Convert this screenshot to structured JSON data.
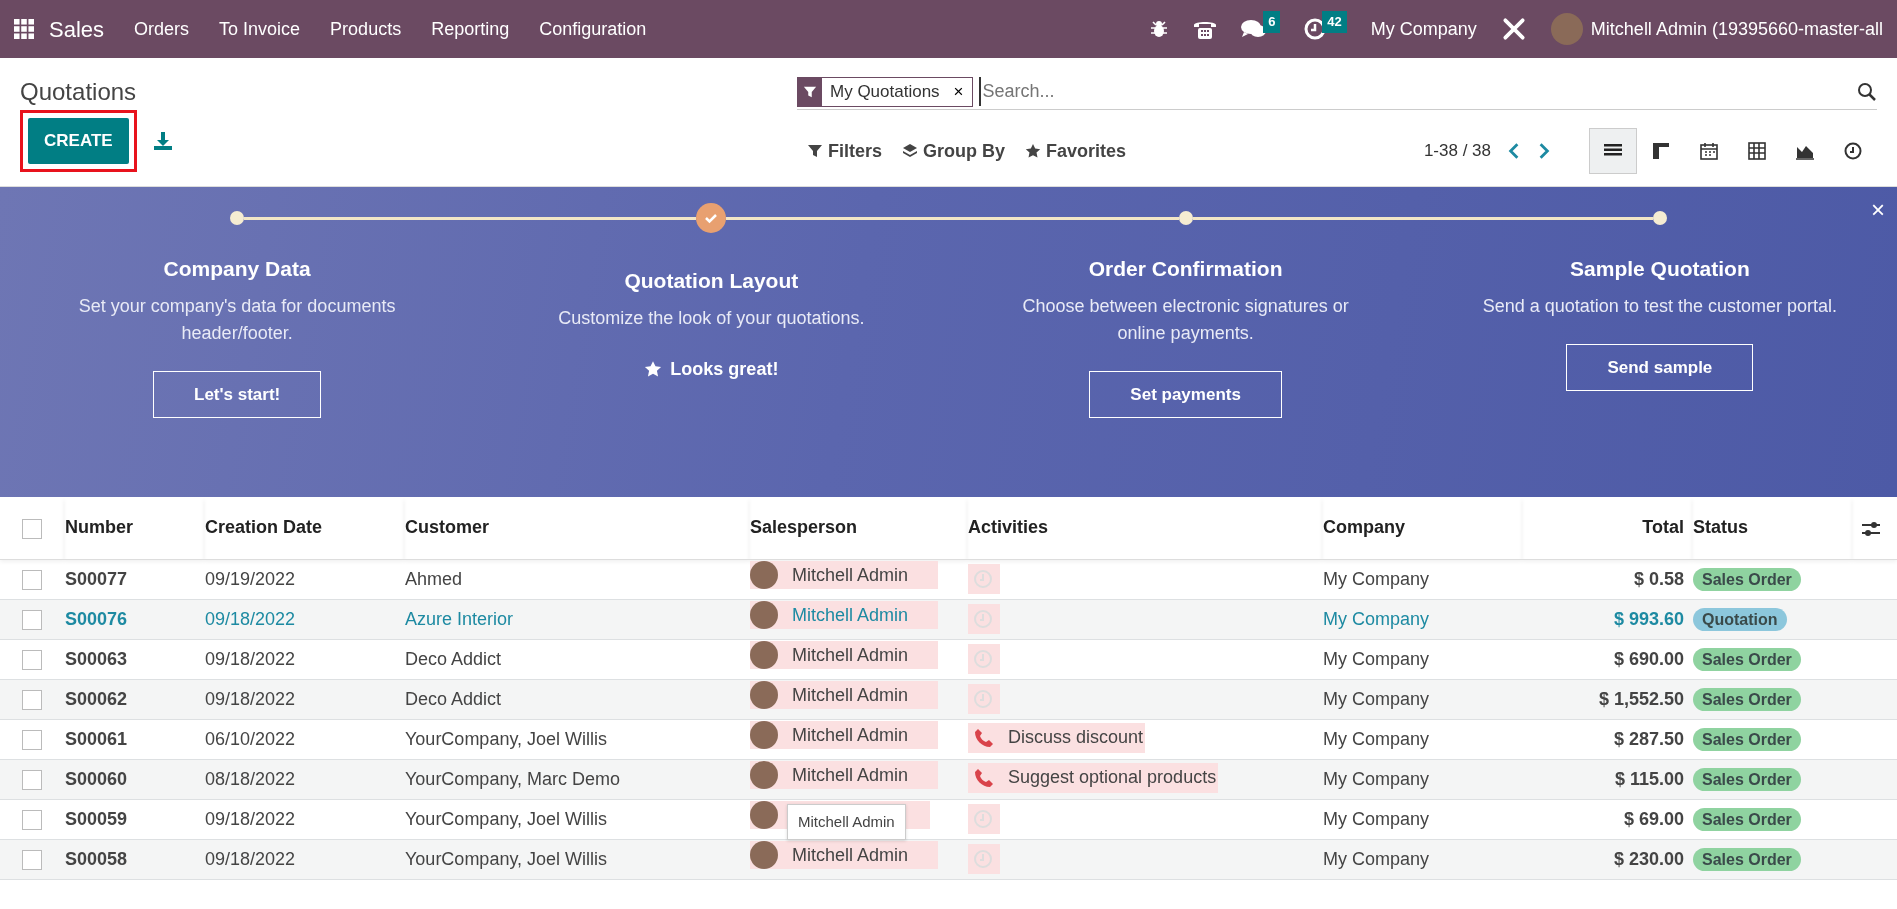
{
  "navbar": {
    "app": "Sales",
    "menu": [
      "Orders",
      "To Invoice",
      "Products",
      "Reporting",
      "Configuration"
    ],
    "messages_count": "6",
    "activities_count": "42",
    "company": "My Company",
    "user": "Mitchell Admin (19395660-master-all"
  },
  "control_panel": {
    "title": "Quotations",
    "create_button": {
      "label": "CREATE",
      "highlighted": true
    },
    "search": {
      "facet": "My Quotations",
      "remove_label": "×",
      "placeholder": "Search..."
    },
    "search_options": [
      {
        "kind": "filter",
        "label": "Filters"
      },
      {
        "kind": "group",
        "label": "Group By"
      },
      {
        "kind": "favorite",
        "label": "Favorites"
      }
    ],
    "pager": "1-38 / 38",
    "views": [
      {
        "kind": "list",
        "selected": true
      },
      {
        "kind": "kanban",
        "selected": false
      },
      {
        "kind": "calendar",
        "selected": false
      },
      {
        "kind": "pivot",
        "selected": false
      },
      {
        "kind": "graph",
        "selected": false
      },
      {
        "kind": "activity",
        "selected": false
      }
    ]
  },
  "onboarding": {
    "close_label": "×",
    "steps": [
      {
        "title": "Company Data",
        "description": "Set your company's data for documents header/footer.",
        "done": false,
        "action": "Let's start!"
      },
      {
        "title": "Quotation Layout",
        "description": "Customize the look of your quotations.",
        "done": true,
        "action": "Looks great!"
      },
      {
        "title": "Order Confirmation",
        "description": "Choose between electronic signatures or online payments.",
        "done": false,
        "action": "Set payments"
      },
      {
        "title": "Sample Quotation",
        "description": "Send a quotation to test the customer portal.",
        "done": false,
        "action": "Send sample"
      }
    ]
  },
  "table": {
    "select_all_checked": false,
    "columns": [
      "Number",
      "Creation Date",
      "Customer",
      "Salesperson",
      "Activities",
      "Company",
      "Total",
      "Status"
    ],
    "rows": [
      {
        "number": "S00077",
        "date": "09/19/2022",
        "customer": "Ahmed",
        "salesperson": "Mitchell Admin",
        "activity": {
          "kind": "none"
        },
        "company": "My Company",
        "total": "$ 0.58",
        "status": {
          "label": "Sales Order",
          "color": "#8fd3a0"
        },
        "hovered": false
      },
      {
        "number": "S00076",
        "date": "09/18/2022",
        "customer": "Azure Interior",
        "salesperson": "Mitchell Admin",
        "activity": {
          "kind": "none"
        },
        "company": "My Company",
        "total": "$ 993.60",
        "status": {
          "label": "Quotation",
          "color": "#8cc7dc"
        },
        "hovered": true
      },
      {
        "number": "S00063",
        "date": "09/18/2022",
        "customer": "Deco Addict",
        "salesperson": "Mitchell Admin",
        "activity": {
          "kind": "none"
        },
        "company": "My Company",
        "total": "$ 690.00",
        "status": {
          "label": "Sales Order",
          "color": "#8fd3a0"
        },
        "hovered": false
      },
      {
        "number": "S00062",
        "date": "09/18/2022",
        "customer": "Deco Addict",
        "salesperson": "Mitchell Admin",
        "activity": {
          "kind": "none"
        },
        "company": "My Company",
        "total": "$ 1,552.50",
        "status": {
          "label": "Sales Order",
          "color": "#8fd3a0"
        },
        "hovered": false
      },
      {
        "number": "S00061",
        "date": "06/10/2022",
        "customer": "YourCompany, Joel Willis",
        "salesperson": "Mitchell Admin",
        "activity": {
          "kind": "call",
          "text": "Discuss discount"
        },
        "company": "My Company",
        "total": "$ 287.50",
        "status": {
          "label": "Sales Order",
          "color": "#8fd3a0"
        },
        "hovered": false
      },
      {
        "number": "S00060",
        "date": "08/18/2022",
        "customer": "YourCompany, Marc Demo",
        "salesperson": "Mitchell Admin",
        "activity": {
          "kind": "call",
          "text": "Suggest optional products"
        },
        "company": "My Company",
        "total": "$ 115.00",
        "status": {
          "label": "Sales Order",
          "color": "#8fd3a0"
        },
        "hovered": false
      },
      {
        "number": "S00059",
        "date": "09/18/2022",
        "customer": "YourCompany, Joel Willis",
        "activity": {
          "kind": "none"
        },
        "company": "My Company",
        "total": "$ 69.00",
        "status": {
          "label": "Sales Order",
          "color": "#8fd3a0"
        },
        "hovered": false,
        "tooltip": "Mitchell Admin"
      },
      {
        "number": "S00058",
        "date": "09/18/2022",
        "customer": "YourCompany, Joel Willis",
        "salesperson": "Mitchell Admin",
        "activity": {
          "kind": "none"
        },
        "company": "My Company",
        "total": "$ 230.00",
        "status": {
          "label": "Sales Order",
          "color": "#8fd3a0"
        },
        "hovered": false
      }
    ]
  }
}
